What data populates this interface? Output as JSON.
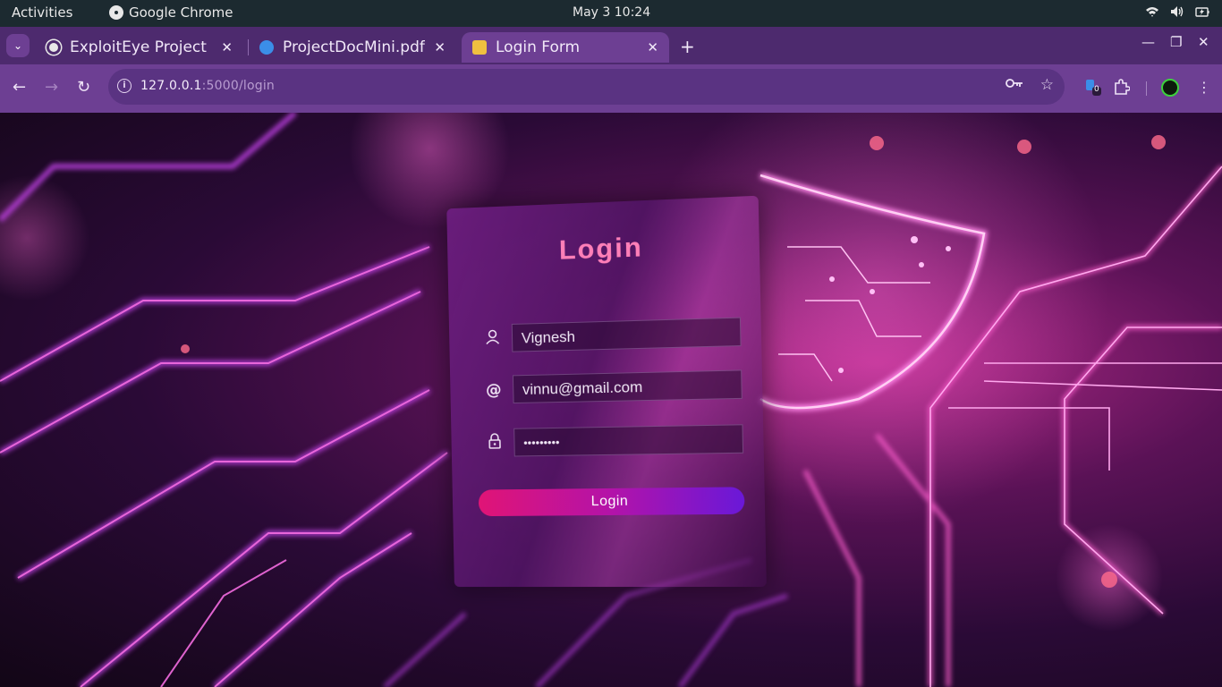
{
  "system_bar": {
    "activities": "Activities",
    "app_name": "Google Chrome",
    "clock": "May 3  10:24"
  },
  "tabs": [
    {
      "title": "ExploitEye Project",
      "favicon_color": "#e8e8e8",
      "active": false
    },
    {
      "title": "ProjectDocMini.pdf",
      "favicon_color": "#3b8ee8",
      "active": false
    },
    {
      "title": "Login Form",
      "favicon_color": "#f0c040",
      "active": true
    }
  ],
  "address_bar": {
    "host": "127.0.0.1",
    "path": ":5000/login"
  },
  "extensions": {
    "badge_count": "0"
  },
  "login_form": {
    "title": "Login",
    "username_value": "Vignesh",
    "email_value": "vinnu@gmail.com",
    "password_masked": "•••••••••",
    "submit_label": "Login"
  },
  "colors": {
    "tab_strip": "#4d2a6e",
    "toolbar": "#6d3f93",
    "title_pink": "#ff7fb8",
    "button_start": "#e01476",
    "button_end": "#6a18d8"
  }
}
